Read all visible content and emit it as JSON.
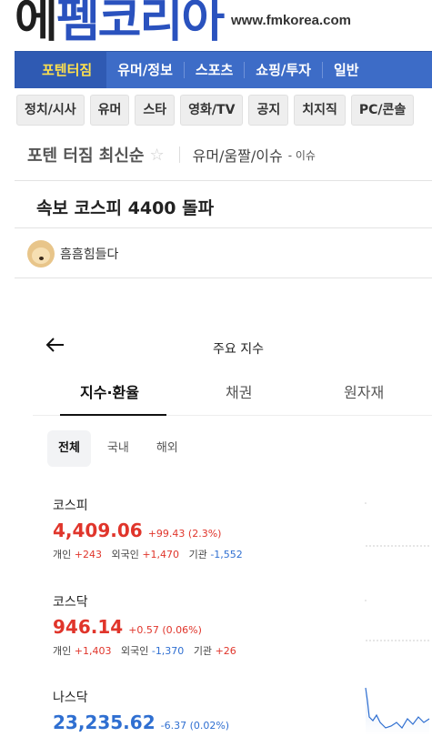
{
  "site": {
    "logo_part1": "에",
    "logo_part2": "펨코리아",
    "url": "www.fmkorea.com"
  },
  "nav": [
    {
      "label": "포텐터짐",
      "active": true
    },
    {
      "label": "유머/정보",
      "active": false
    },
    {
      "label": "스포츠",
      "active": false
    },
    {
      "label": "쇼핑/투자",
      "active": false
    },
    {
      "label": "일반",
      "active": false
    }
  ],
  "subnav": [
    "정치/시사",
    "유머",
    "스타",
    "영화/TV",
    "공지",
    "치지직",
    "PC/콘솔"
  ],
  "board": {
    "title": "포텐 터짐 최신순",
    "category": "유머/움짤/이슈",
    "sub": "- 이슈"
  },
  "post": {
    "title": "속보 코스피 4400 돌파",
    "author": "흠흠힘들다"
  },
  "app": {
    "title": "주요 지수",
    "tabs": [
      "지수·환율",
      "채권",
      "원자재"
    ],
    "segments": [
      "전체",
      "국내",
      "해외"
    ],
    "indices": [
      {
        "name": "코스피",
        "value": "4,409.06",
        "change": "+99.43 (2.3%)",
        "dir": "up",
        "individual_label": "개인",
        "individual": "+243",
        "foreign_label": "외국인",
        "foreign": "+1,470",
        "institution_label": "기관",
        "institution": "-1,552"
      },
      {
        "name": "코스닥",
        "value": "946.14",
        "change": "+0.57 (0.06%)",
        "dir": "up",
        "individual_label": "개인",
        "individual": "+1,403",
        "foreign_label": "외국인",
        "foreign": "-1,370",
        "institution_label": "기관",
        "institution": "+26"
      },
      {
        "name": "나스닥",
        "value": "23,235.62",
        "change": "-6.37 (0.02%)",
        "dir": "down"
      }
    ]
  },
  "colors": {
    "nav_bg": "#3d6cc7",
    "up": "#e0352b",
    "down": "#2f6fd1",
    "active_nav_text": "#ffe14d"
  }
}
